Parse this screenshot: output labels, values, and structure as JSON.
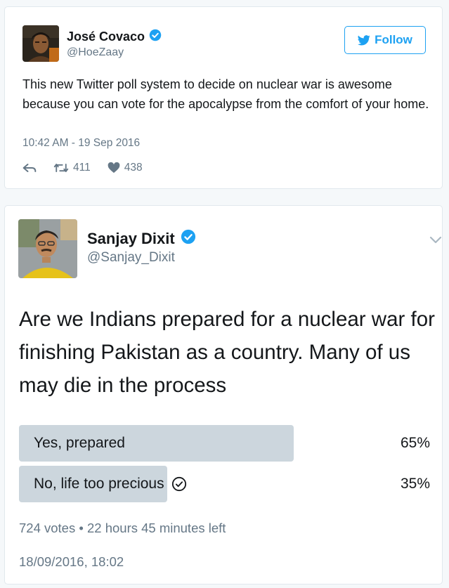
{
  "tweet1": {
    "author_name": "José Covaco",
    "author_handle": "@HoeZaay",
    "follow_label": "Follow",
    "text": "This new Twitter poll system to decide on nuclear war is awesome because you can vote for the apocalypse from the comfort of your home.",
    "timestamp": "10:42 AM - 19 Sep 2016",
    "retweets": "411",
    "likes": "438",
    "verified": true,
    "icons": [
      "reply-icon",
      "retweet-icon",
      "heart-icon",
      "twitter-bird-icon",
      "verified-badge-icon"
    ],
    "colors": {
      "accent": "#1da1f2",
      "muted": "#657786"
    }
  },
  "tweet2": {
    "author_name": "Sanjay Dixit",
    "author_handle": "@Sanjay_Dixit",
    "verified": true,
    "text": "Are we Indians prepared for a nuclear war for finishing Pakistan as a country. Many of us may die in the process",
    "poll": {
      "options": [
        {
          "label": "Yes, prepared",
          "percent_text": "65%",
          "fraction": 0.65,
          "selected": false
        },
        {
          "label": "No, life too precious",
          "percent_text": "35%",
          "fraction": 0.35,
          "selected": true
        }
      ],
      "bar_color": "#ccd6dd"
    },
    "meta": "724 votes • 22 hours 45 minutes left",
    "date": "18/09/2016, 18:02",
    "icons": [
      "chevron-down-icon",
      "verified-badge-icon",
      "check-circle-icon"
    ]
  }
}
